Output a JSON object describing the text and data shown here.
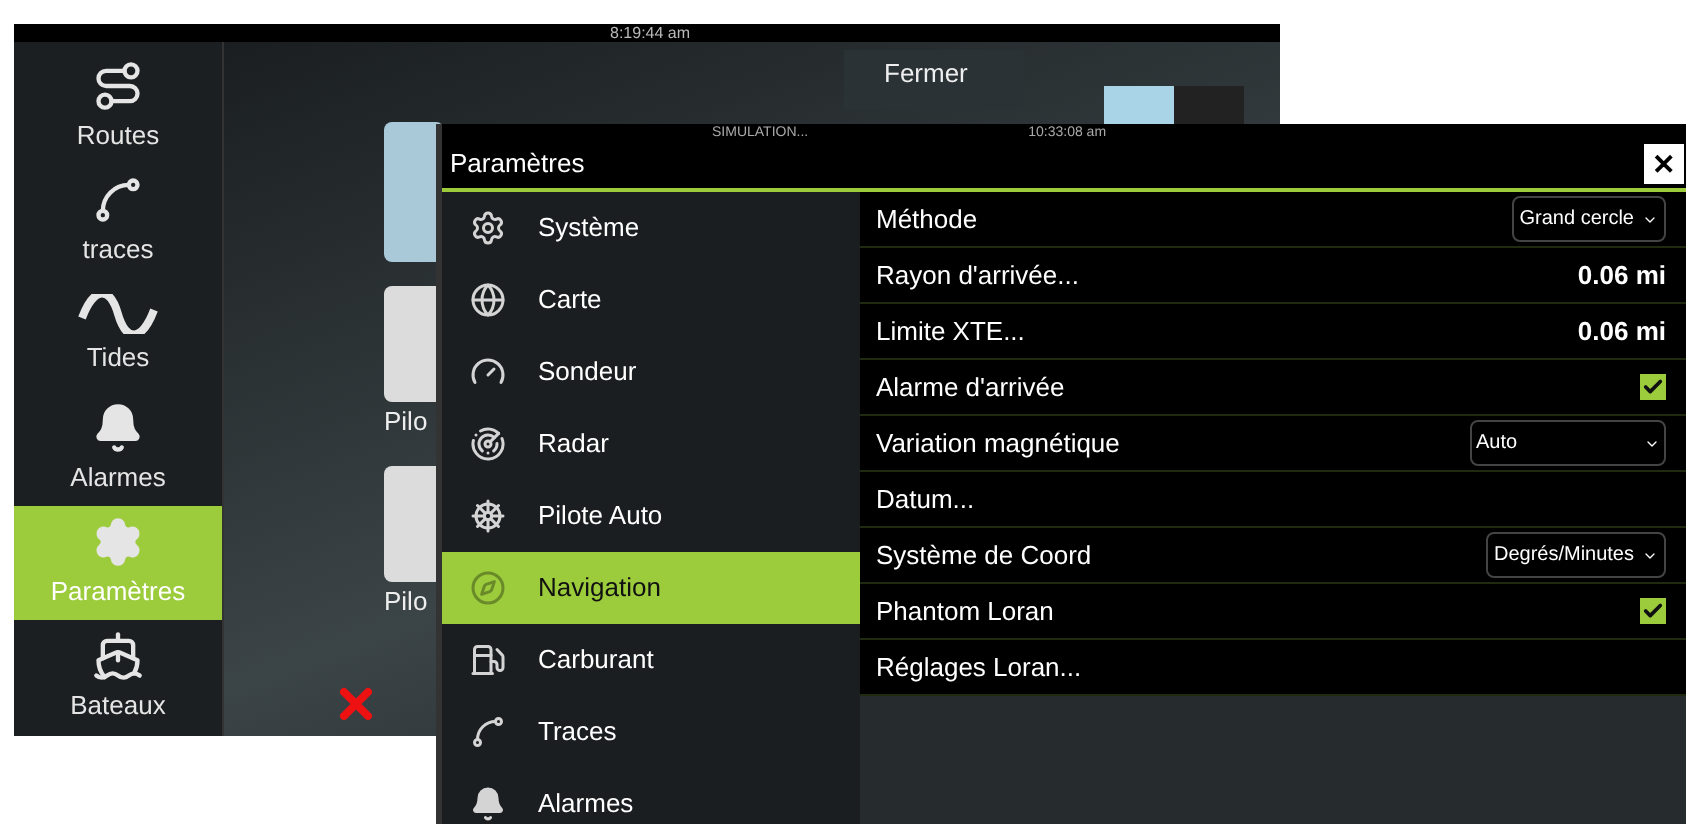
{
  "background_screen": {
    "time": "8:19:44 am",
    "sidebar": {
      "items": [
        {
          "label": "Routes",
          "selected": false
        },
        {
          "label": "traces",
          "selected": false
        },
        {
          "label": "Tides",
          "selected": false
        },
        {
          "label": "Alarmes",
          "selected": false
        },
        {
          "label": "Paramètres",
          "selected": true
        },
        {
          "label": "Bateaux",
          "selected": false
        }
      ]
    },
    "close_button": "Fermer",
    "tile_labels": [
      "Pilo",
      "Pilo"
    ]
  },
  "settings_window": {
    "status": "SIMULATION...",
    "time": "10:33:08 am",
    "title": "Paramètres",
    "close_button": "✕",
    "categories": [
      {
        "label": "Système",
        "selected": false
      },
      {
        "label": "Carte",
        "selected": false
      },
      {
        "label": "Sondeur",
        "selected": false
      },
      {
        "label": "Radar",
        "selected": false
      },
      {
        "label": "Pilote Auto",
        "selected": false
      },
      {
        "label": "Navigation",
        "selected": true
      },
      {
        "label": "Carburant",
        "selected": false
      },
      {
        "label": "Traces",
        "selected": false
      },
      {
        "label": "Alarmes",
        "selected": false
      }
    ],
    "options": [
      {
        "kind": "dropdown",
        "label": "Méthode",
        "value": "Grand cercle"
      },
      {
        "kind": "value",
        "label": "Rayon d'arrivée...",
        "value": "0.06 mi"
      },
      {
        "kind": "value",
        "label": "Limite XTE...",
        "value": "0.06 mi"
      },
      {
        "kind": "checkbox",
        "label": "Alarme d'arrivée",
        "checked": true
      },
      {
        "kind": "wide_dropdown",
        "label": "Variation magnétique",
        "value": "Auto"
      },
      {
        "kind": "link",
        "label": "Datum..."
      },
      {
        "kind": "dropdown",
        "label": "Système de Coord",
        "value": "Degrés/Minutes"
      },
      {
        "kind": "checkbox",
        "label": "Phantom Loran",
        "checked": true
      },
      {
        "kind": "link",
        "label": "Réglages Loran..."
      }
    ]
  }
}
